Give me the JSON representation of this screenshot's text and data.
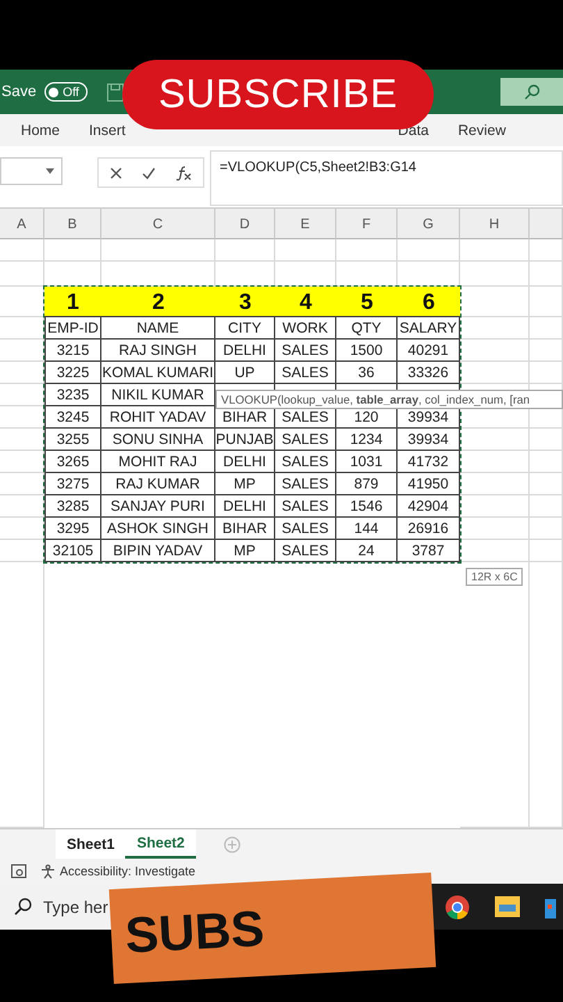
{
  "title_bar": {
    "autosave_label": "Save",
    "autosave_toggle": {
      "label": "Off",
      "on": false
    }
  },
  "overlay_button": "SUBSCRIBE",
  "ribbon_tabs": {
    "left": [
      "Home",
      "Insert"
    ],
    "right": [
      "Data",
      "Review"
    ]
  },
  "formula_bar": {
    "formula": "=VLOOKUP(C5,Sheet2!B3:G14"
  },
  "columns": [
    "A",
    "B",
    "C",
    "D",
    "E",
    "F",
    "G",
    "H"
  ],
  "table": {
    "index_row": [
      "1",
      "2",
      "3",
      "4",
      "5",
      "6"
    ],
    "header": [
      "EMP-ID",
      "NAME",
      "CITY",
      "WORK",
      "QTY",
      "SALARY"
    ],
    "rows": [
      [
        "3215",
        "RAJ SINGH",
        "DELHI",
        "SALES",
        "1500",
        "40291"
      ],
      [
        "3225",
        "KOMAL KUMARI",
        "UP",
        "SALES",
        "36",
        "33326"
      ],
      [
        "3235",
        "NIKIL KUMAR"
      ],
      [
        "3245",
        "ROHIT YADAV",
        "BIHAR",
        "SALES",
        "120",
        "39934"
      ],
      [
        "3255",
        "SONU SINHA",
        "PUNJAB",
        "SALES",
        "1234",
        "39934"
      ],
      [
        "3265",
        "MOHIT RAJ",
        "DELHI",
        "SALES",
        "1031",
        "41732"
      ],
      [
        "3275",
        "RAJ KUMAR",
        "MP",
        "SALES",
        "879",
        "41950"
      ],
      [
        "3285",
        "SANJAY PURI",
        "DELHI",
        "SALES",
        "1546",
        "42904"
      ],
      [
        "3295",
        "ASHOK SINGH",
        "BIHAR",
        "SALES",
        "144",
        "26916"
      ],
      [
        "32105",
        "BIPIN YADAV",
        "MP",
        "SALES",
        "24",
        "3787"
      ]
    ]
  },
  "tooltip": "VLOOKUP(lookup_value, **table_array**, col_index_num, [ran",
  "selection_size": "12R x 6C",
  "sheet_tabs": [
    {
      "label": "Sheet1",
      "selected": false
    },
    {
      "label": "Sheet2",
      "selected": true
    }
  ],
  "status_bar": {
    "accessibility": "Accessibility: Investigate"
  },
  "taskbar": {
    "search_placeholder": "Type her"
  },
  "banner": "SUBS"
}
